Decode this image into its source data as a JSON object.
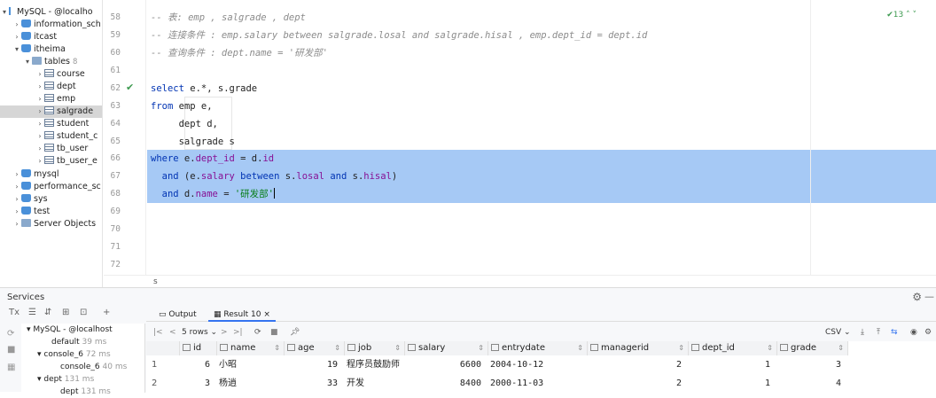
{
  "tree": {
    "root": "MySQL - @localho",
    "items": [
      {
        "label": "information_sch",
        "type": "db"
      },
      {
        "label": "itcast",
        "type": "db"
      },
      {
        "label": "itheima",
        "type": "db"
      },
      {
        "label": "tables",
        "count": "8",
        "type": "folder"
      },
      {
        "label": "course",
        "type": "table"
      },
      {
        "label": "dept",
        "type": "table"
      },
      {
        "label": "emp",
        "type": "table"
      },
      {
        "label": "salgrade",
        "type": "table"
      },
      {
        "label": "student",
        "type": "table"
      },
      {
        "label": "student_c",
        "type": "table"
      },
      {
        "label": "tb_user",
        "type": "table"
      },
      {
        "label": "tb_user_e",
        "type": "table"
      },
      {
        "label": "mysql",
        "type": "db"
      },
      {
        "label": "performance_sc",
        "type": "db"
      },
      {
        "label": "sys",
        "type": "db"
      },
      {
        "label": "test",
        "type": "db"
      },
      {
        "label": "Server Objects",
        "type": "folder"
      }
    ]
  },
  "editor": {
    "line_numbers": [
      "58",
      "59",
      "60",
      "61",
      "62",
      "63",
      "64",
      "65",
      "66",
      "67",
      "68",
      "69",
      "70",
      "71",
      "72"
    ],
    "inspection_count": "13",
    "comment1": "-- 表: emp , salgrade , dept",
    "comment2": "-- 连接条件 : emp.salary between salgrade.losal and salgrade.hisal , emp.dept_id = dept.id",
    "comment3": "-- 查询条件 : dept.name = '研发部'",
    "l62_kw": "select",
    "l62_rest": " e.*, s.grade",
    "l63_kw": "from",
    "l63_rest": " emp e,",
    "l64": "     dept d,",
    "l65": "     salgrade s",
    "l66_kw": "where",
    "l66_a": " e.",
    "l66_f1": "dept_id",
    "l66_b": " = d.",
    "l66_f2": "id",
    "l67_kw1": "  and",
    "l67_a": " (e.",
    "l67_f1": "salary",
    "l67_kw2": " between",
    "l67_b": " s.",
    "l67_f2": "losal",
    "l67_kw3": " and",
    "l67_c": " s.",
    "l67_f3": "hisal",
    "l67_d": ")",
    "l68_kw": "  and",
    "l68_a": " d.",
    "l68_f": "name",
    "l68_b": " = ",
    "l68_str": "'研发部'"
  },
  "status_bar": {
    "text": "s"
  },
  "services": {
    "title": "Services",
    "tree": [
      {
        "label": "MySQL - @localhost",
        "time": ""
      },
      {
        "label": "default",
        "time": "39 ms"
      },
      {
        "label": "console_6",
        "time": "72 ms"
      },
      {
        "label": "console_6",
        "time": "40 ms"
      },
      {
        "label": "dept",
        "time": "131 ms"
      },
      {
        "label": "dept",
        "time": "131 ms"
      }
    ]
  },
  "results": {
    "tabs": [
      "Output",
      "Result 10"
    ],
    "rows_label": "5 rows",
    "export_format": "CSV",
    "columns": [
      "id",
      "name",
      "age",
      "job",
      "salary",
      "entrydate",
      "managerid",
      "dept_id",
      "grade"
    ],
    "rows": [
      [
        "1",
        "6",
        "小昭",
        "19",
        "程序员鼓励师",
        "6600",
        "2004-10-12",
        "2",
        "1",
        "3"
      ],
      [
        "2",
        "3",
        "杨逍",
        "33",
        "开发",
        "8400",
        "2000-11-03",
        "2",
        "1",
        "4"
      ]
    ]
  },
  "colors": {
    "selection": "#a6c9f5",
    "keyword": "#0033b3",
    "string": "#067d17",
    "accent": "#3574f0"
  }
}
